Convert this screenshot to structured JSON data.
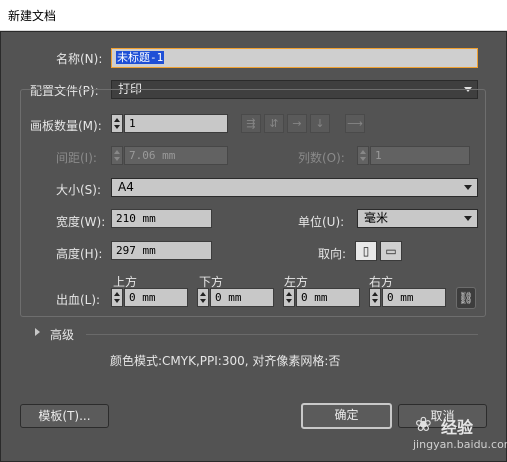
{
  "window": {
    "title": "新建文档"
  },
  "name_row": {
    "label": "名称(N):",
    "value": "未标题-1"
  },
  "profile": {
    "label": "配置文件(P):",
    "value": "打印"
  },
  "artboards": {
    "label": "画板数量(M):",
    "value": "1",
    "layout_icons": [
      "grid-by-row-icon",
      "grid-by-column-icon",
      "arrange-by-row-icon",
      "arrange-by-column-icon",
      "right-to-left-icon"
    ]
  },
  "spacing": {
    "label": "间距(I):",
    "value": "7.06 mm"
  },
  "columns": {
    "label": "列数(O):",
    "value": "1"
  },
  "size": {
    "label": "大小(S):",
    "value": "A4"
  },
  "width": {
    "label": "宽度(W):",
    "value": "210 mm"
  },
  "units": {
    "label": "单位(U):",
    "value": "毫米"
  },
  "height": {
    "label": "高度(H):",
    "value": "297 mm"
  },
  "orientation": {
    "label": "取向:",
    "portrait_icon": "portrait-icon",
    "landscape_icon": "landscape-icon"
  },
  "bleed": {
    "label": "出血(L):",
    "top": {
      "label": "上方",
      "value": "0 mm"
    },
    "bottom": {
      "label": "下方",
      "value": "0 mm"
    },
    "left": {
      "label": "左方",
      "value": "0 mm"
    },
    "right": {
      "label": "右方",
      "value": "0 mm"
    },
    "link_icon": "chain-link-icon"
  },
  "advanced": {
    "label": "高级"
  },
  "summary": "颜色模式:CMYK,PPI:300, 对齐像素网格:否",
  "buttons": {
    "templates": "模板(T)...",
    "ok": "确定",
    "cancel": "取消"
  },
  "watermark": {
    "brand": "经验",
    "url": "jingyan.baidu.com"
  },
  "colors": {
    "background": "#535353",
    "selection": "#1e4fd6",
    "focus_border": "#f0a030"
  }
}
